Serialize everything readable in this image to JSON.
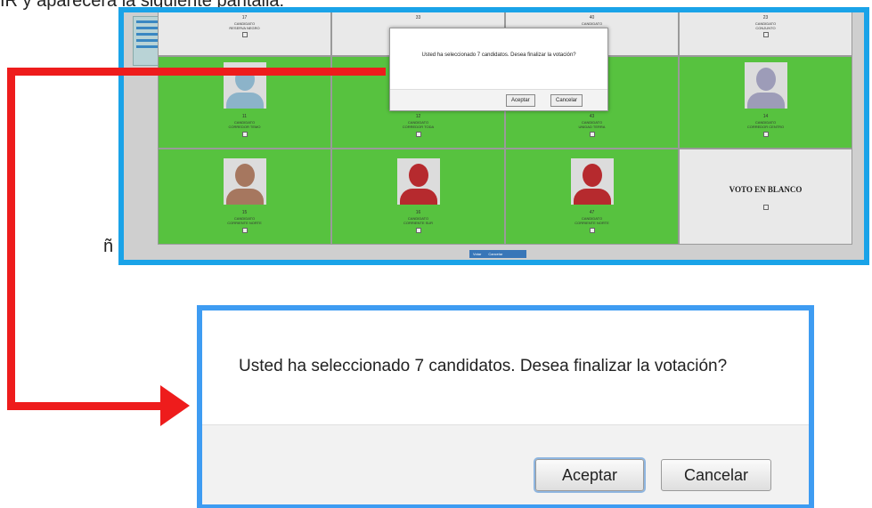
{
  "doc": {
    "top_text": "IR y aparecerá la siguiente pantalla:",
    "stray_char": "ñ"
  },
  "screenshot": {
    "top_row": [
      {
        "num": "17",
        "label": "CANDIDATO\nRESERVA NEGRO"
      },
      {
        "num": "33",
        "label": ""
      },
      {
        "num": "40",
        "label": "CANDIDATO"
      },
      {
        "num": "23",
        "label": "CANDIDATO\nCONJUNTO"
      }
    ],
    "middle_row": [
      {
        "num": "11",
        "label": "CANDIDATO\nCORREDOR TEMO",
        "avatar": "blue"
      },
      {
        "num": "12",
        "label": "CANDIDATO\nCORREDOR TODA",
        "avatar": "none"
      },
      {
        "num": "43",
        "label": "CANDIDATO\nUNIDAD TERRA",
        "avatar": "none"
      },
      {
        "num": "14",
        "label": "CANDIDATO\nCORREDOR CENTRO",
        "avatar": "purple"
      }
    ],
    "bottom_row": [
      {
        "num": "15",
        "label": "CANDIDATO\nCORRIENTE NORTE",
        "avatar": "brown"
      },
      {
        "num": "16",
        "label": "CANDIDATO\nCORRIENTE SUR",
        "avatar": "red"
      },
      {
        "num": "47",
        "label": "CANDIDATO\nCORRIENTE NORTE",
        "avatar": "red"
      }
    ],
    "blank_vote": "VOTO EN BLANCO",
    "dialog": {
      "message": "Usted ha seleccionado 7  candidatos. Desea finalizar la votación?",
      "accept": "Aceptar",
      "cancel": "Cancelar"
    },
    "bottom_buttons": [
      "Votar",
      "Cancelar"
    ]
  },
  "dialog": {
    "message": "Usted ha seleccionado 7  candidatos. Desea finalizar la votación?",
    "accept_label": "Aceptar",
    "cancel_label": "Cancelar"
  },
  "colors": {
    "panel_border": "#1aa3e8",
    "zoom_border": "#3e9cf2",
    "arrow": "#ee1c1c",
    "cell_green": "#57c23f"
  }
}
